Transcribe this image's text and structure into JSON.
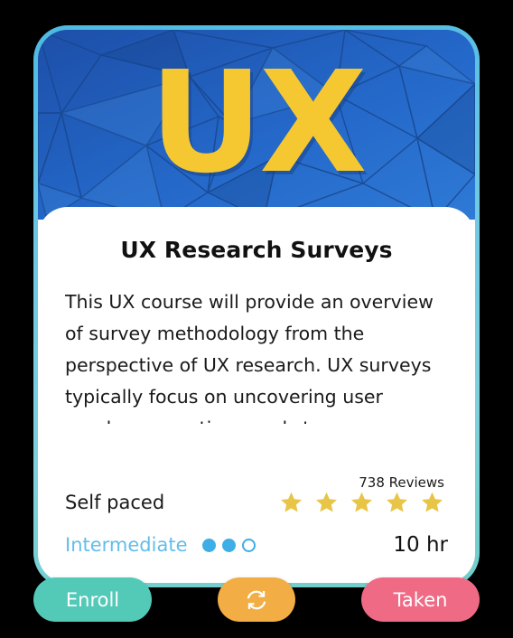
{
  "card": {
    "hero": {
      "logo_text": "UX",
      "icon": "ux-logo-image",
      "bg_color": "#1f5fc0",
      "logo_color": "#f5c832"
    },
    "title": "UX Research Surveys",
    "description": "This UX course will provide an overview of survey methodology from the perspective of UX research. UX surveys typically focus on uncovering user needs, connecting needs to user",
    "reviews": "738 Reviews",
    "rating": {
      "stars_filled": 5,
      "stars_total": 5,
      "star_color": "#e8c547"
    },
    "pace": "Self paced",
    "level": {
      "label": "Intermediate",
      "filled_dots": 2,
      "total_dots": 3,
      "color": "#63bdea"
    },
    "duration": "10 hr",
    "border_color": "#6cc8e4"
  },
  "actions": {
    "enroll": {
      "label": "Enroll",
      "color": "#53c9b8"
    },
    "sync": {
      "label": "",
      "icon": "refresh-sync-icon",
      "color": "#f2ad45"
    },
    "taken": {
      "label": "Taken",
      "color": "#ef6a85"
    }
  }
}
